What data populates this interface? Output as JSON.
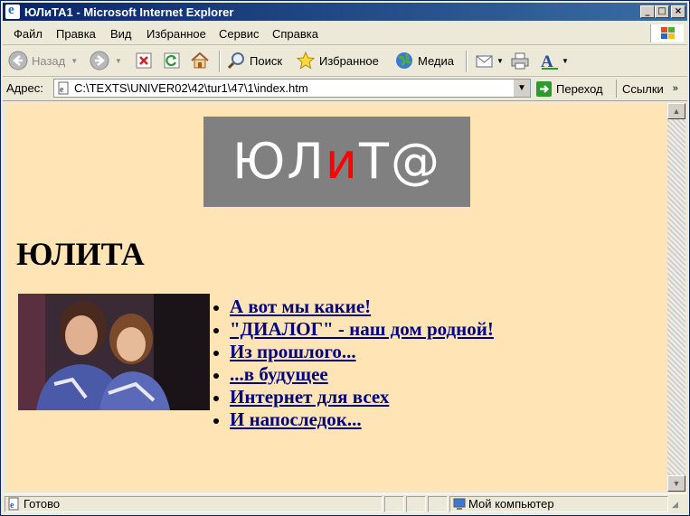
{
  "window": {
    "title": "ЮЛиТА1 - Microsoft Internet Explorer",
    "minimize": "_",
    "maximize": "□",
    "close": "×"
  },
  "menu": {
    "file": "Файл",
    "edit": "Правка",
    "view": "Вид",
    "favorites": "Избранное",
    "tools": "Сервис",
    "help": "Справка"
  },
  "toolbar": {
    "back": "Назад",
    "search": "Поиск",
    "favorites": "Избранное",
    "media": "Медиа"
  },
  "address": {
    "label": "Адрес:",
    "value": "C:\\TEXTS\\UNIVER02\\42\\tur1\\47\\1\\index.htm",
    "go": "Переход",
    "links": "Ссылки"
  },
  "page": {
    "logo_part1": "ЮЛ",
    "logo_part2": "и",
    "logo_part3": "Т@",
    "heading": "ЮЛИТА",
    "links": [
      "А вот мы какие!",
      "\"ДИАЛОГ\" - наш дом родной!",
      "Из прошлого...",
      "...в будущее",
      "Интернет для всех",
      "И напоследок..."
    ]
  },
  "status": {
    "text": "Готово",
    "zone": "Мой компьютер"
  },
  "colors": {
    "page_background": "#ffe4b5",
    "link": "#000080",
    "logo_background": "#808080",
    "logo_accent": "#ff0000"
  }
}
